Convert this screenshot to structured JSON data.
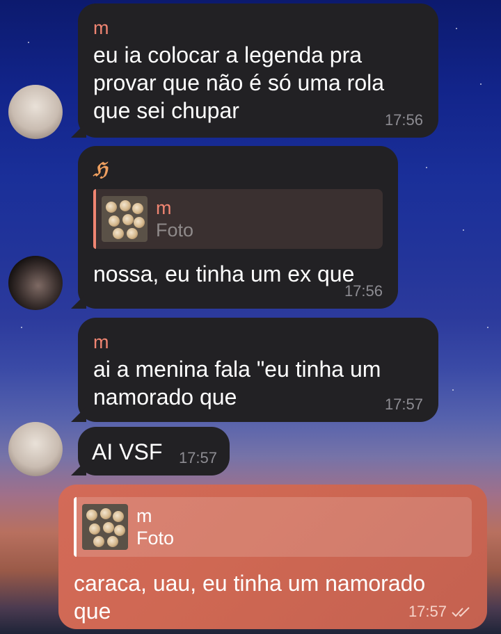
{
  "messages": [
    {
      "sender": "m",
      "lines": "eu ia colocar a legenda pra\nprovar que não é só uma rola\nque sei chupar",
      "time": "17:56"
    },
    {
      "sender": "ℌ",
      "reply": {
        "name": "m",
        "sub": "Foto"
      },
      "lines": "nossa, eu tinha um ex que",
      "time": "17:56"
    },
    {
      "sender": "m",
      "lines": "ai a menina fala \"eu tinha um\nnamorado que",
      "time": "17:57"
    },
    {
      "lines": "AI VSF",
      "time": "17:57"
    },
    {
      "reply": {
        "name": "m",
        "sub": "Foto"
      },
      "lines": "caraca, uau, eu tinha um namorado\nque",
      "time": "17:57",
      "status": "read-double-check"
    }
  ],
  "icons": {
    "read_status": "double-check-icon"
  },
  "colors": {
    "incoming_bubble": "#222124",
    "sender_name": "#f08572",
    "outgoing_bubble": "#d36a58"
  }
}
